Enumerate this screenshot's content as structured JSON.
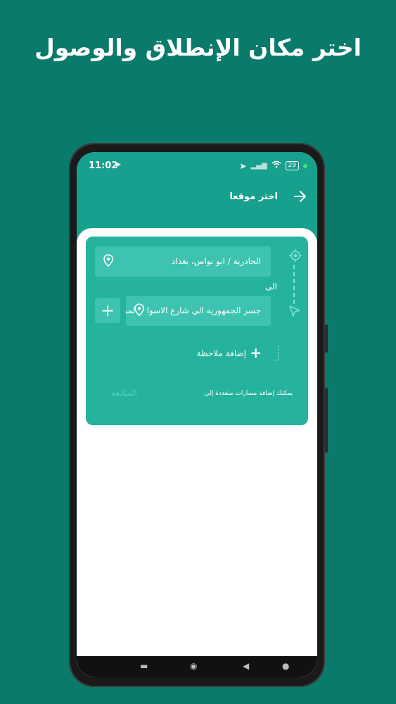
{
  "headline": "اختر مكان الإنطلاق والوصول",
  "status_bar": {
    "time": "11:02",
    "battery": "29"
  },
  "header": {
    "title": "اختر موقعا",
    "back_icon": "arrow-right-icon"
  },
  "form": {
    "origin_value": "الجادرية / ابو نواس، بغداد",
    "to_label": "الى",
    "destination_value": "جسر الجمهوريه الي شارع الاسواق المركزيه، بغداد",
    "add_stop_icon": "plus-icon",
    "add_note_label": "إضافة ملاحظة",
    "hint_text": "يمكنك إضافة مسارات متعددة إلى",
    "continue_label": "المتابعة"
  },
  "colors": {
    "background": "#0a7a6b",
    "header": "#16a08d",
    "card": "#25b39e",
    "field": "#3dc3af"
  }
}
